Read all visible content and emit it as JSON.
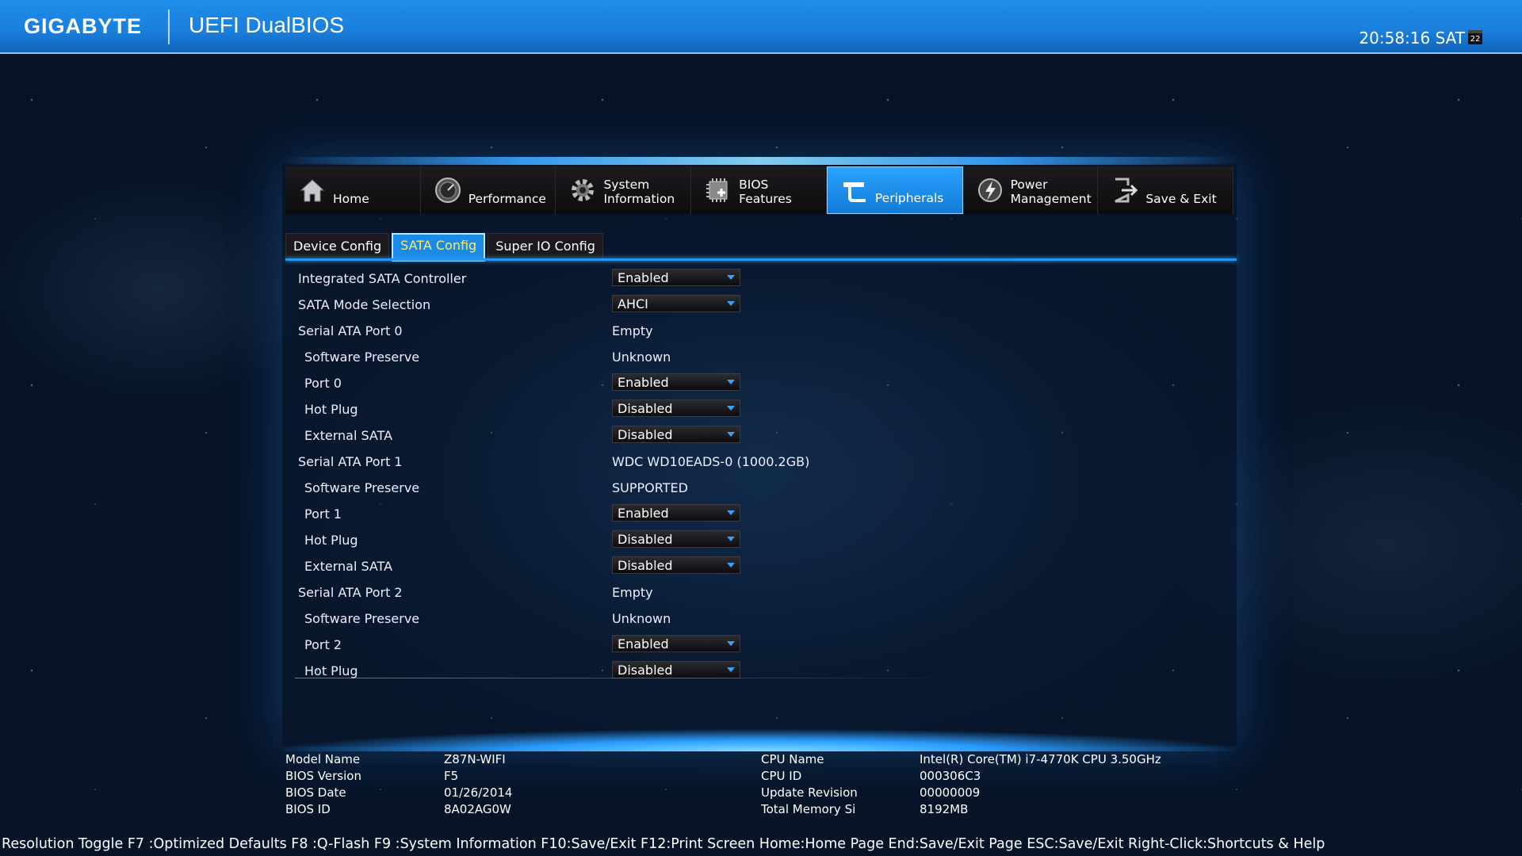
{
  "header": {
    "brand": "GIGABYTE",
    "product": "UEFI DualBIOS",
    "clock": "20:58:16 SAT",
    "calendar_day": "22"
  },
  "nav": {
    "items": [
      {
        "label": "Home",
        "icon": "home-icon",
        "active": false
      },
      {
        "label": "Performance",
        "icon": "gauge-icon",
        "active": false
      },
      {
        "label": "System\nInformation",
        "icon": "gear-icon",
        "active": false
      },
      {
        "label": "BIOS\nFeatures",
        "icon": "chip-icon",
        "active": false
      },
      {
        "label": "Peripherals",
        "icon": "peripherals-icon",
        "active": true
      },
      {
        "label": "Power\nManagement",
        "icon": "power-icon",
        "active": false
      },
      {
        "label": "Save & Exit",
        "icon": "exit-icon",
        "active": false
      }
    ]
  },
  "subtabs": [
    {
      "label": "Device Config",
      "active": false
    },
    {
      "label": "SATA Config",
      "active": true
    },
    {
      "label": "Super IO Config",
      "active": false
    }
  ],
  "settings": [
    {
      "label": "Integrated SATA Controller",
      "value": "Enabled",
      "type": "dropdown",
      "indent": false
    },
    {
      "label": "SATA Mode Selection",
      "value": "AHCI",
      "type": "dropdown",
      "indent": false
    },
    {
      "label": "Serial ATA Port 0",
      "value": "Empty",
      "type": "text",
      "indent": false
    },
    {
      "label": "Software Preserve",
      "value": "Unknown",
      "type": "text",
      "indent": true
    },
    {
      "label": "Port 0",
      "value": "Enabled",
      "type": "dropdown",
      "indent": true
    },
    {
      "label": "Hot Plug",
      "value": "Disabled",
      "type": "dropdown",
      "indent": true
    },
    {
      "label": "External SATA",
      "value": "Disabled",
      "type": "dropdown",
      "indent": true
    },
    {
      "label": "Serial ATA Port 1",
      "value": "WDC WD10EADS-0 (1000.2GB)",
      "type": "text",
      "indent": false
    },
    {
      "label": "Software Preserve",
      "value": "SUPPORTED",
      "type": "text",
      "indent": true
    },
    {
      "label": "Port 1",
      "value": "Enabled",
      "type": "dropdown",
      "indent": true
    },
    {
      "label": "Hot Plug",
      "value": "Disabled",
      "type": "dropdown",
      "indent": true
    },
    {
      "label": "External SATA",
      "value": "Disabled",
      "type": "dropdown",
      "indent": true
    },
    {
      "label": "Serial ATA Port 2",
      "value": "Empty",
      "type": "text",
      "indent": false
    },
    {
      "label": "Software Preserve",
      "value": "Unknown",
      "type": "text",
      "indent": true
    },
    {
      "label": "Port 2",
      "value": "Enabled",
      "type": "dropdown",
      "indent": true
    },
    {
      "label": "Hot Plug",
      "value": "Disabled",
      "type": "dropdown",
      "indent": true
    }
  ],
  "system_info": {
    "left": [
      {
        "key": "Model Name",
        "value": "Z87N-WIFI"
      },
      {
        "key": "BIOS Version",
        "value": "F5"
      },
      {
        "key": "BIOS Date",
        "value": "01/26/2014"
      },
      {
        "key": "BIOS ID",
        "value": "8A02AG0W"
      }
    ],
    "right": [
      {
        "key": "CPU Name",
        "value": "Intel(R) Core(TM) i7-4770K CPU  3.50GHz"
      },
      {
        "key": "CPU ID",
        "value": "000306C3"
      },
      {
        "key": "Update Revision",
        "value": "00000009"
      },
      {
        "key": "Total Memory Si",
        "value": "8192MB"
      }
    ]
  },
  "hint_bar": "Resolution Toggle F7 :Optimized Defaults F8 :Q-Flash F9 :System Information F10:Save/Exit F12:Print Screen Home:Home Page End:Save/Exit Page ESC:Save/Exit Right-Click:Shortcuts & Help",
  "colors": {
    "accent": "#1a8be6",
    "topbar": "#1e8eea",
    "active_tab_text": "#ffe86a"
  }
}
